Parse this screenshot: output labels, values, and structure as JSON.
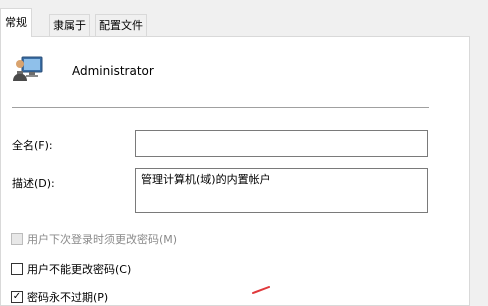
{
  "tabs": [
    {
      "label": "常规",
      "active": true
    },
    {
      "label": "隶属于",
      "active": false
    },
    {
      "label": "配置文件",
      "active": false
    }
  ],
  "user": {
    "icon": "user-computer-icon",
    "name": "Administrator"
  },
  "form": {
    "full_name": {
      "label": "全名(F):",
      "value": ""
    },
    "description": {
      "label": "描述(D):",
      "value": "管理计算机(域)的内置帐户"
    }
  },
  "checkboxes": [
    {
      "label": "用户下次登录时须更改密码(M)",
      "checked": false,
      "disabled": true
    },
    {
      "label": "用户不能更改密码(C)",
      "checked": false,
      "disabled": false
    },
    {
      "label": "密码永不过期(P)",
      "checked": true,
      "disabled": false
    }
  ],
  "colors": {
    "panel_bg": "#ffffff",
    "window_bg": "#f0f0f0",
    "annotation": "#e0383b"
  }
}
